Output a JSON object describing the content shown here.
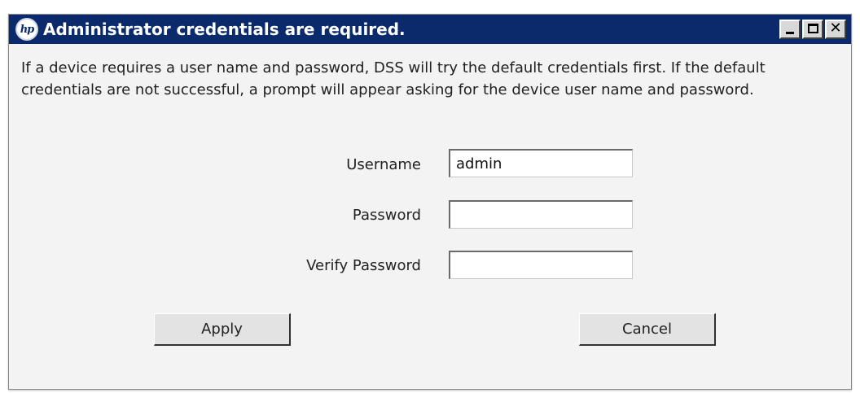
{
  "window": {
    "title": "Administrator credentials are required.",
    "logo_text": "hp",
    "controls": {
      "minimize": "_",
      "maximize": "□",
      "close": "✕"
    }
  },
  "message": "If a device requires a user name and password, DSS will try the default credentials first.  If the default credentials are not successful, a prompt will appear asking for the device user name and password.",
  "form": {
    "username_label": "Username",
    "username_value": "admin",
    "password_label": "Password",
    "password_value": "",
    "verify_password_label": "Verify Password",
    "verify_password_value": ""
  },
  "buttons": {
    "apply": "Apply",
    "cancel": "Cancel"
  },
  "colors": {
    "titlebar": "#0a2a6b",
    "dialog_bg": "#f3f3f3"
  },
  "icons": {
    "logo": "hp-logo-icon",
    "minimize": "minimize-icon",
    "maximize": "maximize-icon",
    "close": "close-icon"
  }
}
